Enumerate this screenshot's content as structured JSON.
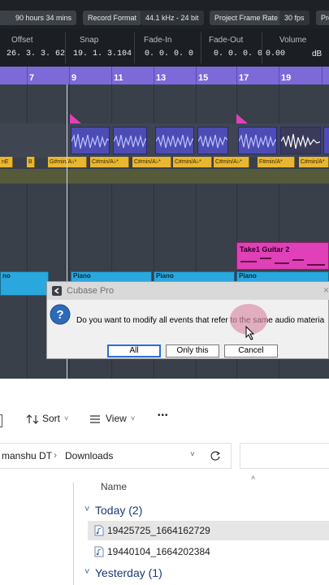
{
  "status_bar": {
    "duration": "90 hours 34 mins",
    "record_format_label": "Record Format",
    "record_format_value": "44.1 kHz - 24 bit",
    "frame_rate_label": "Project Frame Rate",
    "frame_rate_value": "30 fps",
    "cut_label": "Pro"
  },
  "info_line": {
    "offset_label": "Offset",
    "offset_value": "26. 3. 3. 62",
    "snap_label": "Snap",
    "snap_value": "19. 1. 3.104",
    "fadein_label": "Fade-In",
    "fadein_value": "0. 0. 0.   0",
    "fadeout_label": "Fade-Out",
    "fadeout_value": "0. 0. 0.   0",
    "volume_label": "Volume",
    "volume_value": "0.00",
    "volume_unit": "dB"
  },
  "ruler": {
    "ticks": [
      "7",
      "9",
      "11",
      "13",
      "15",
      "17",
      "19"
    ]
  },
  "project": {
    "chords": [
      "nE",
      "B",
      "G#min/A♭*",
      "C#min/A♭*",
      "C#min/A♭*",
      "C#min/A♭*",
      "C#min/A♭*",
      "F#min/A*",
      "C#min/A*"
    ],
    "guitar_event": "Take1 Guitar 2",
    "piano_label": "Piano",
    "piano_left_label": "no"
  },
  "dialog": {
    "title": "Cubase Pro",
    "message": "Do you want to modify all events that refer to the same audio materia",
    "btn_all": "All",
    "btn_only_this": "Only this",
    "btn_cancel": "Cancel"
  },
  "explorer": {
    "toolbar": {
      "sort": "Sort",
      "view": "View",
      "more": "•••"
    },
    "breadcrumb": {
      "part1": "manshu DT",
      "part2": "Downloads"
    },
    "column_name": "Name",
    "groups": [
      {
        "label": "Today (2)",
        "files": [
          "19425725_1664162729",
          "19440104_1664202384"
        ]
      },
      {
        "label": "Yesterday (1)"
      }
    ]
  },
  "colors": {
    "ruler": "#7c6ad8",
    "audio": "#4d4bb4",
    "chord": "#e8b630",
    "piano": "#2aa7dc",
    "guitar": "#e040b8"
  }
}
